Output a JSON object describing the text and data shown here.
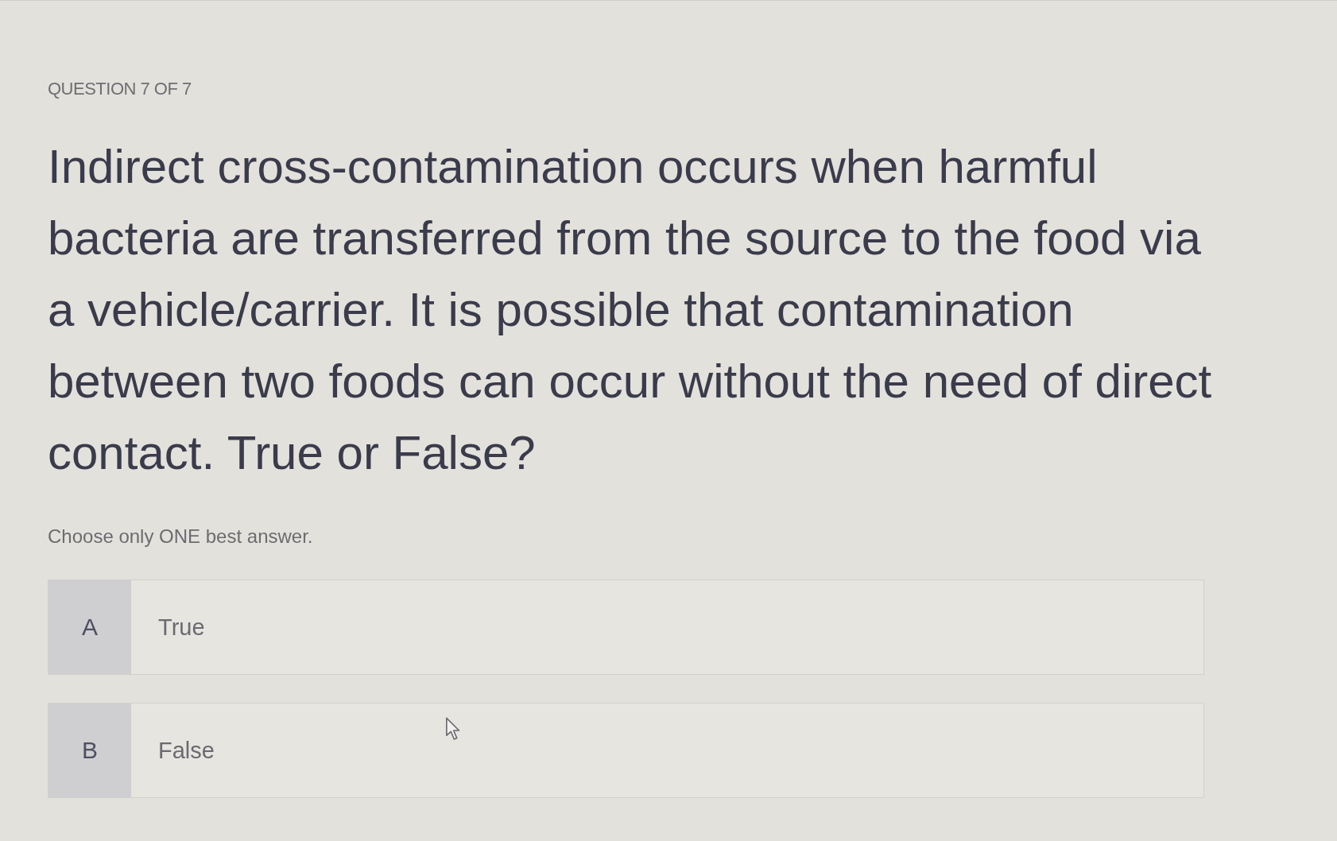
{
  "header": {
    "counter": "QUESTION 7 OF 7"
  },
  "question": {
    "text": "Indirect cross-contamination occurs when harmful bacteria are transferred from the source to the food via a vehicle/carrier. It is possible that contamination between two foods can occur without the need of direct contact. True or False?",
    "instruction": "Choose only ONE best answer."
  },
  "options": [
    {
      "letter": "A",
      "label": "True",
      "selected": false
    },
    {
      "letter": "B",
      "label": "False",
      "selected": false
    }
  ]
}
